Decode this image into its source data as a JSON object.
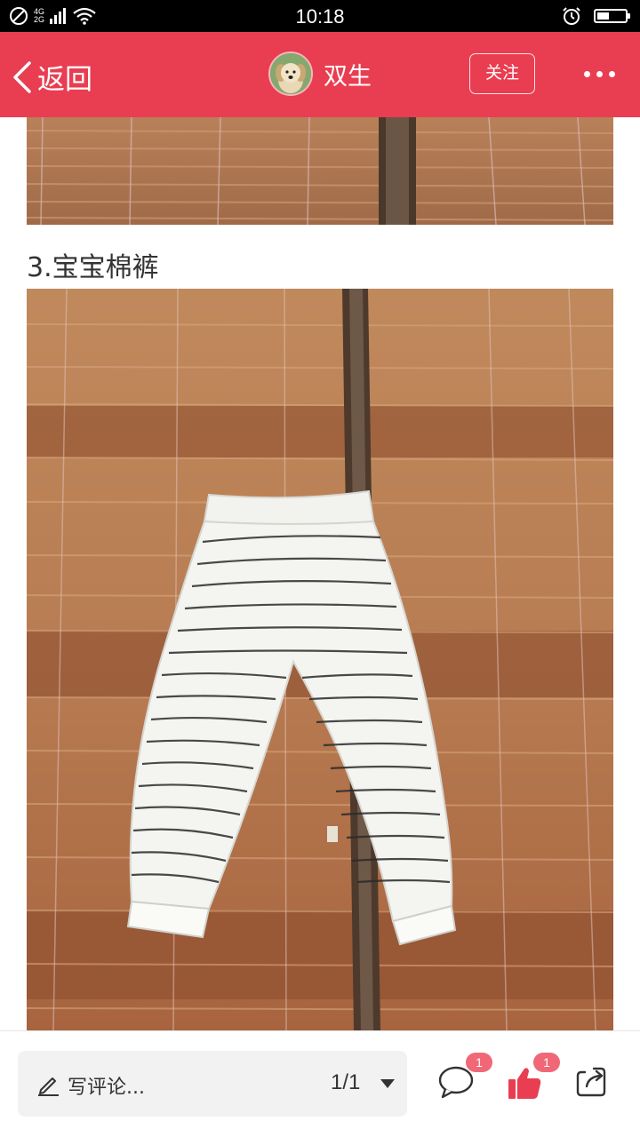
{
  "status_bar": {
    "time": "10:18",
    "network_top": "4G",
    "network_bottom": "2G",
    "icons": [
      "do-not-disturb-icon",
      "signal-icon",
      "wifi-icon",
      "alarm-icon",
      "battery-icon"
    ],
    "battery_level": 0.45
  },
  "header": {
    "back_label": "返回",
    "username": "双生",
    "follow_label": "关注",
    "background_color": "#e93d51"
  },
  "content": {
    "caption": "3.宝宝棉裤"
  },
  "bottom_bar": {
    "comment_placeholder": "写评论...",
    "page_indicator": "1/1",
    "comment_count": "1",
    "like_count": "1",
    "like_color": "#e93d51",
    "badge_color": "#f06877"
  }
}
